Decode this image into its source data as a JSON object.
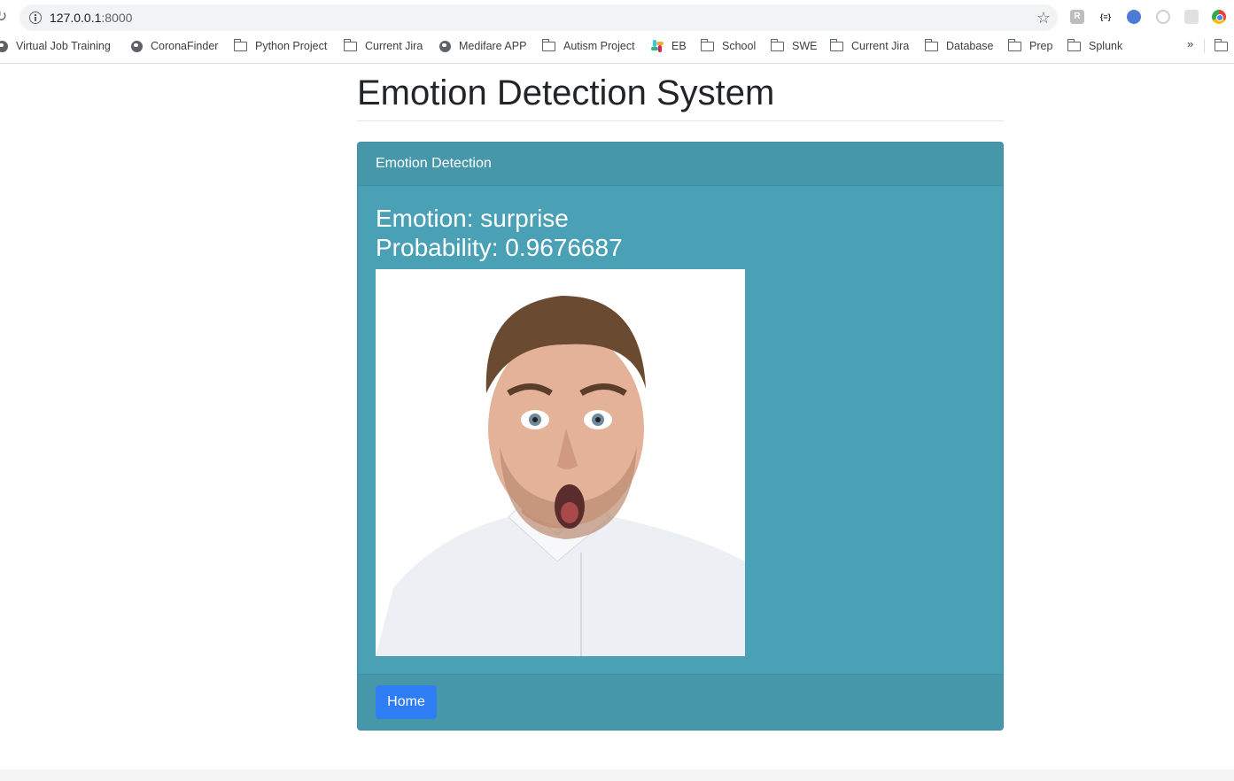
{
  "browser": {
    "url_host": "127.0.0.1",
    "url_port": ":8000",
    "bookmarks": [
      {
        "label": "Virtual Job Training",
        "icon": "globe-icon"
      },
      {
        "label": "CoronaFinder",
        "icon": "globe-icon"
      },
      {
        "label": "Python Project",
        "icon": "folder-icon"
      },
      {
        "label": "Current Jira",
        "icon": "folder-icon"
      },
      {
        "label": "Medifare APP",
        "icon": "globe-icon"
      },
      {
        "label": "Autism Project",
        "icon": "folder-icon"
      },
      {
        "label": "EB",
        "icon": "slack-icon"
      },
      {
        "label": "School",
        "icon": "folder-icon"
      },
      {
        "label": "SWE",
        "icon": "folder-icon"
      },
      {
        "label": "Current Jira",
        "icon": "folder-icon"
      },
      {
        "label": "Database",
        "icon": "folder-icon"
      },
      {
        "label": "Prep",
        "icon": "folder-icon"
      },
      {
        "label": "Splunk",
        "icon": "folder-icon"
      }
    ],
    "more_label": "»"
  },
  "page": {
    "title": "Emotion Detection System",
    "card_header": "Emotion Detection",
    "emotion_line": "Emotion: surprise",
    "probability_line": "Probability: 0.9676687",
    "home_button": "Home"
  },
  "colors": {
    "card_bg": "#4aa0b5",
    "button_bg": "#2f7df5"
  }
}
